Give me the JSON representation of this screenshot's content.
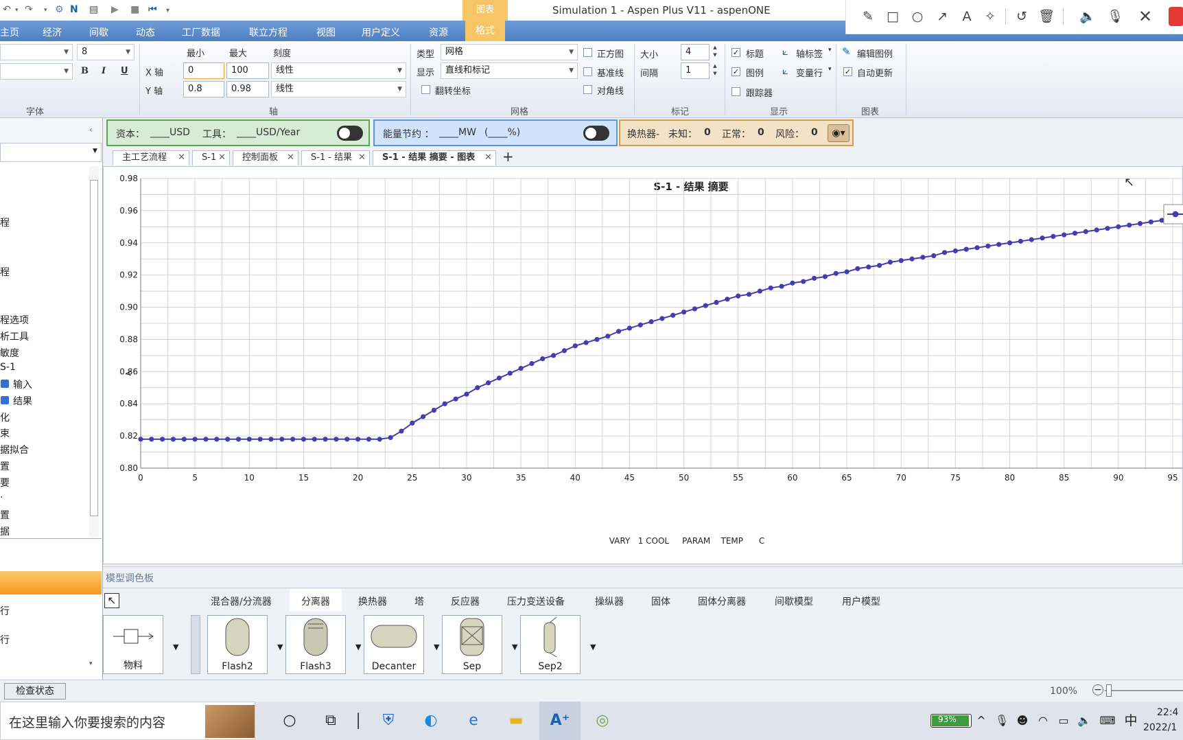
{
  "window": {
    "title": "Simulation 1 - Aspen Plus V11 - aspenONE",
    "context_tab": "图表"
  },
  "menu": {
    "tabs": [
      "主页",
      "经济",
      "间歇",
      "动态",
      "工厂数据",
      "联立方程",
      "视图",
      "用户定义",
      "资源",
      "格式"
    ],
    "active": "格式"
  },
  "ribbon": {
    "font": {
      "font_size": "8",
      "bold": "B",
      "italic": "I",
      "underline": "U",
      "caption": "字体"
    },
    "axis": {
      "min_label": "最小",
      "max_label": "最大",
      "scale_label": "刻度",
      "x_label": "X 轴",
      "y_label": "Y 轴",
      "x_min": "0",
      "x_max": "100",
      "x_scale": "线性",
      "y_min": "0.8",
      "y_max": "0.98",
      "y_scale": "线性",
      "caption": "轴"
    },
    "grid": {
      "type_label": "类型",
      "type_value": "网格",
      "display_label": "显示",
      "display_value": "直线和标记",
      "flip_label": "翻转坐标",
      "square_label": "正方图",
      "baseline_label": "基准线",
      "diagonal_label": "对角线",
      "caption": "网格"
    },
    "marker": {
      "size_label": "大小",
      "size_value": "4",
      "interval_label": "间隔",
      "interval_value": "1",
      "caption": "标记"
    },
    "display": {
      "title_label": "标题",
      "legend_label": "图例",
      "tracker_label": "跟踪器",
      "axis_label_btn": "轴标签",
      "variable_row_btn": "变量行",
      "caption": "显示"
    },
    "chart": {
      "edit_legend": "编辑图例",
      "auto_update": "自动更新",
      "caption": "图表"
    }
  },
  "status_strip": {
    "capital": "资本：",
    "capital_unit": "____USD",
    "utility": "工具：",
    "utility_unit": "____USD/Year",
    "energy": "能量节约 ：",
    "energy_unit": "____MW",
    "energy_pct": "(____%)",
    "hx": "换热器-",
    "unknown_label": "未知：",
    "unknown_value": "0",
    "normal_label": "正常：",
    "normal_value": "0",
    "risk_label": "风险：",
    "risk_value": "0"
  },
  "nav": {
    "items": [
      "程",
      "程",
      "程选项",
      "析工具",
      "敏度",
      "S-1",
      "输入",
      "结果",
      "化",
      "束",
      "据拟合",
      "置",
      "要",
      "·",
      "置",
      "据"
    ],
    "bottom_items": [
      "行",
      "行"
    ]
  },
  "doc_tabs": [
    "主工艺流程",
    "S-1",
    "控制面板",
    "S-1 - 结果",
    "S-1 - 结果 摘要 - 图表"
  ],
  "chart_data": {
    "type": "line",
    "title": "S-1 - 结果 摘要",
    "xlabel": "VARY   1 COOL     PARAM    TEMP      C",
    "ylabel": "<",
    "xlim": [
      0,
      100
    ],
    "ylim": [
      0.8,
      0.98
    ],
    "x_ticks": [
      0,
      5,
      10,
      15,
      20,
      25,
      30,
      35,
      40,
      45,
      50,
      55,
      60,
      65,
      70,
      75,
      80,
      85,
      90,
      95
    ],
    "y_ticks": [
      "0.80",
      "0.82",
      "0.84",
      "0.86",
      "0.88",
      "0.90",
      "0.92",
      "0.94",
      "0.96",
      "0.98"
    ],
    "grid": true,
    "legend": "right",
    "color": "#3f3fae",
    "series": [
      {
        "x": [
          0,
          1,
          2,
          3,
          4,
          5,
          6,
          7,
          8,
          9,
          10,
          11,
          12,
          13,
          14,
          15,
          16,
          17,
          18,
          19,
          20,
          21,
          22,
          23,
          24,
          25,
          26,
          27,
          28,
          29,
          30,
          31,
          32,
          33,
          34,
          35,
          36,
          37,
          38,
          39,
          40,
          41,
          42,
          43,
          44,
          45,
          46,
          47,
          48,
          49,
          50,
          51,
          52,
          53,
          54,
          55,
          56,
          57,
          58,
          59,
          60,
          61,
          62,
          63,
          64,
          65,
          66,
          67,
          68,
          69,
          70,
          71,
          72,
          73,
          74,
          75,
          76,
          77,
          78,
          79,
          80,
          81,
          82,
          83,
          84,
          85,
          86,
          87,
          88,
          89,
          90,
          91,
          92,
          93,
          94,
          95,
          96
        ],
        "y": [
          0.818,
          0.818,
          0.818,
          0.818,
          0.818,
          0.818,
          0.818,
          0.818,
          0.818,
          0.818,
          0.818,
          0.818,
          0.818,
          0.818,
          0.818,
          0.818,
          0.818,
          0.818,
          0.818,
          0.818,
          0.818,
          0.818,
          0.818,
          0.819,
          0.823,
          0.828,
          0.832,
          0.836,
          0.84,
          0.843,
          0.846,
          0.85,
          0.853,
          0.856,
          0.859,
          0.862,
          0.865,
          0.868,
          0.87,
          0.873,
          0.876,
          0.878,
          0.88,
          0.882,
          0.885,
          0.887,
          0.889,
          0.891,
          0.893,
          0.895,
          0.897,
          0.899,
          0.901,
          0.903,
          0.905,
          0.907,
          0.908,
          0.91,
          0.912,
          0.913,
          0.915,
          0.916,
          0.918,
          0.919,
          0.921,
          0.922,
          0.924,
          0.925,
          0.926,
          0.928,
          0.929,
          0.93,
          0.931,
          0.932,
          0.934,
          0.935,
          0.936,
          0.937,
          0.938,
          0.939,
          0.94,
          0.941,
          0.942,
          0.943,
          0.944,
          0.945,
          0.946,
          0.947,
          0.948,
          0.949,
          0.95,
          0.951,
          0.952,
          0.953,
          0.954,
          0.955,
          0.957
        ]
      }
    ]
  },
  "palette": {
    "title": "模型调色板",
    "tabs": [
      "混合器/分流器",
      "分离器",
      "换热器",
      "塔",
      "反应器",
      "压力变送设备",
      "操纵器",
      "固体",
      "固体分离器",
      "间歇模型",
      "用户模型"
    ],
    "active_tab": "分离器",
    "items": [
      "物料",
      "Flash2",
      "Flash3",
      "Decanter",
      "Sep",
      "Sep2"
    ]
  },
  "statusbar": {
    "check_button": "检查状态",
    "zoom": "100%"
  },
  "taskbar": {
    "search_placeholder": "在这里输入你要搜索的内容",
    "battery": "93%",
    "ime": "中",
    "time": "22:4",
    "date": "2022/1"
  }
}
